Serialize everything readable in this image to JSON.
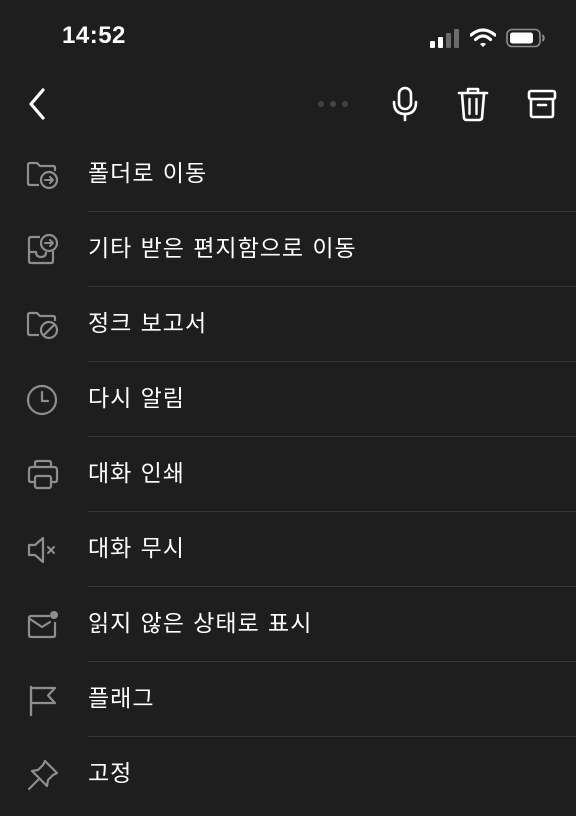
{
  "status_bar": {
    "time": "14:52",
    "signal_icon": "signal-bars-icon",
    "wifi_icon": "wifi-icon",
    "battery_icon": "battery-icon"
  },
  "toolbar": {
    "back_icon": "chevron-left-icon",
    "more_icon": "more-dots-icon",
    "mic_icon": "microphone-icon",
    "delete_icon": "trash-icon",
    "archive_icon": "archive-icon"
  },
  "menu": {
    "items": [
      {
        "label": "폴더로 이동",
        "icon": "folder-move-icon"
      },
      {
        "label": "기타 받은 편지함으로 이동",
        "icon": "inbox-move-icon"
      },
      {
        "label": "정크 보고서",
        "icon": "folder-block-icon"
      },
      {
        "label": "다시 알림",
        "icon": "clock-icon"
      },
      {
        "label": "대화 인쇄",
        "icon": "printer-icon"
      },
      {
        "label": "대화 무시",
        "icon": "speaker-mute-icon"
      },
      {
        "label": "읽지 않은 상태로 표시",
        "icon": "mail-unread-icon"
      },
      {
        "label": "플래그",
        "icon": "flag-icon"
      },
      {
        "label": "고정",
        "icon": "pin-icon"
      }
    ]
  },
  "colors": {
    "background": "#1e1e1e",
    "text": "#ffffff",
    "icon": "#8e8e8e",
    "divider": "#343434"
  }
}
